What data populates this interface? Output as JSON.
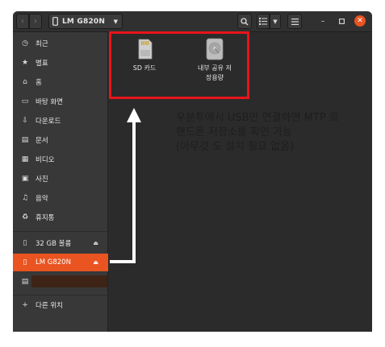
{
  "headerbar": {
    "location_label": "LM G820N"
  },
  "sidebar": {
    "items": [
      {
        "label": "최근",
        "icon": "clock-icon"
      },
      {
        "label": "별표",
        "icon": "star-icon"
      },
      {
        "label": "홈",
        "icon": "home-icon"
      },
      {
        "label": "바탕 화면",
        "icon": "desktop-icon"
      },
      {
        "label": "다운로드",
        "icon": "download-icon"
      },
      {
        "label": "문서",
        "icon": "document-icon"
      },
      {
        "label": "비디오",
        "icon": "video-icon"
      },
      {
        "label": "사진",
        "icon": "picture-icon"
      },
      {
        "label": "음악",
        "icon": "music-icon"
      },
      {
        "label": "휴지통",
        "icon": "trash-icon"
      }
    ],
    "devices": [
      {
        "label": "32 GB 볼륨",
        "icon": "usb-drive-icon"
      },
      {
        "label": "LM G820N",
        "icon": "phone-icon",
        "active": true
      }
    ],
    "other_locations": "다른 위치"
  },
  "content": {
    "files": [
      {
        "label": "SD 카드",
        "icon": "sd-card-icon"
      },
      {
        "label_line1": "내부 공유 저",
        "label_line2": "장용량",
        "icon": "internal-storage-icon"
      }
    ]
  },
  "annotation": {
    "line1": "우분투에서 USB만 연결하면 MTP 로",
    "line2": "핸드폰 저장소를 확인 가능",
    "line3": "(아무것 도 설치 필요 없음)"
  },
  "colors": {
    "accent": "#e95420",
    "highlight_border": "#e8141b"
  }
}
